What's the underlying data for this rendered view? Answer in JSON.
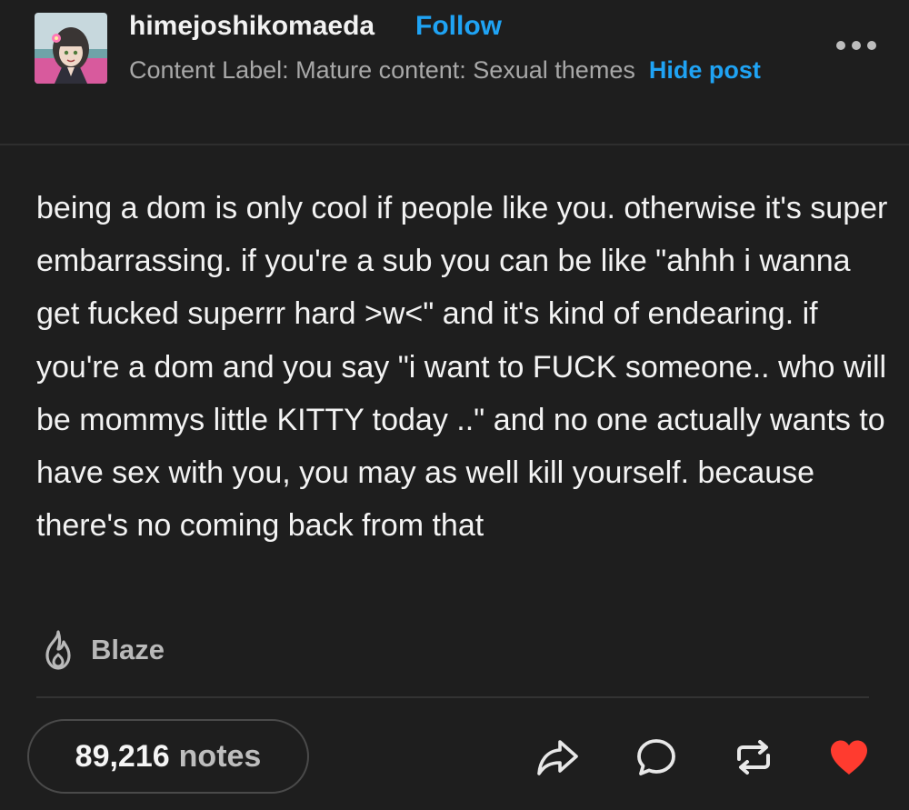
{
  "post": {
    "username": "himejoshikomaeda",
    "follow_label": "Follow",
    "content_label": "Content Label: Mature content: Sexual themes",
    "hide_post_label": "Hide post",
    "body": "being a dom is only cool if people like you. otherwise it's super embarrassing. if you're a sub you can be like \"ahhh i wanna get fucked superrr hard >w<\" and it's kind of endearing. if you're a dom and you say \"i want to FUCK someone.. who will be mommys little KITTY today ..\" and no one actually wants to have sex with you, you may as well kill yourself. because there's no coming back from that",
    "blaze_label": "Blaze"
  },
  "footer": {
    "notes_count": "89,216",
    "notes_word": "notes"
  },
  "icons": {
    "more": "more-options-icon",
    "blaze": "flame-icon",
    "share": "share-icon",
    "reply": "reply-icon",
    "reblog": "reblog-icon",
    "like": "heart-icon"
  },
  "colors": {
    "background": "#1e1e1e",
    "accent": "#1fa3f4",
    "like": "#ff3b2f"
  }
}
